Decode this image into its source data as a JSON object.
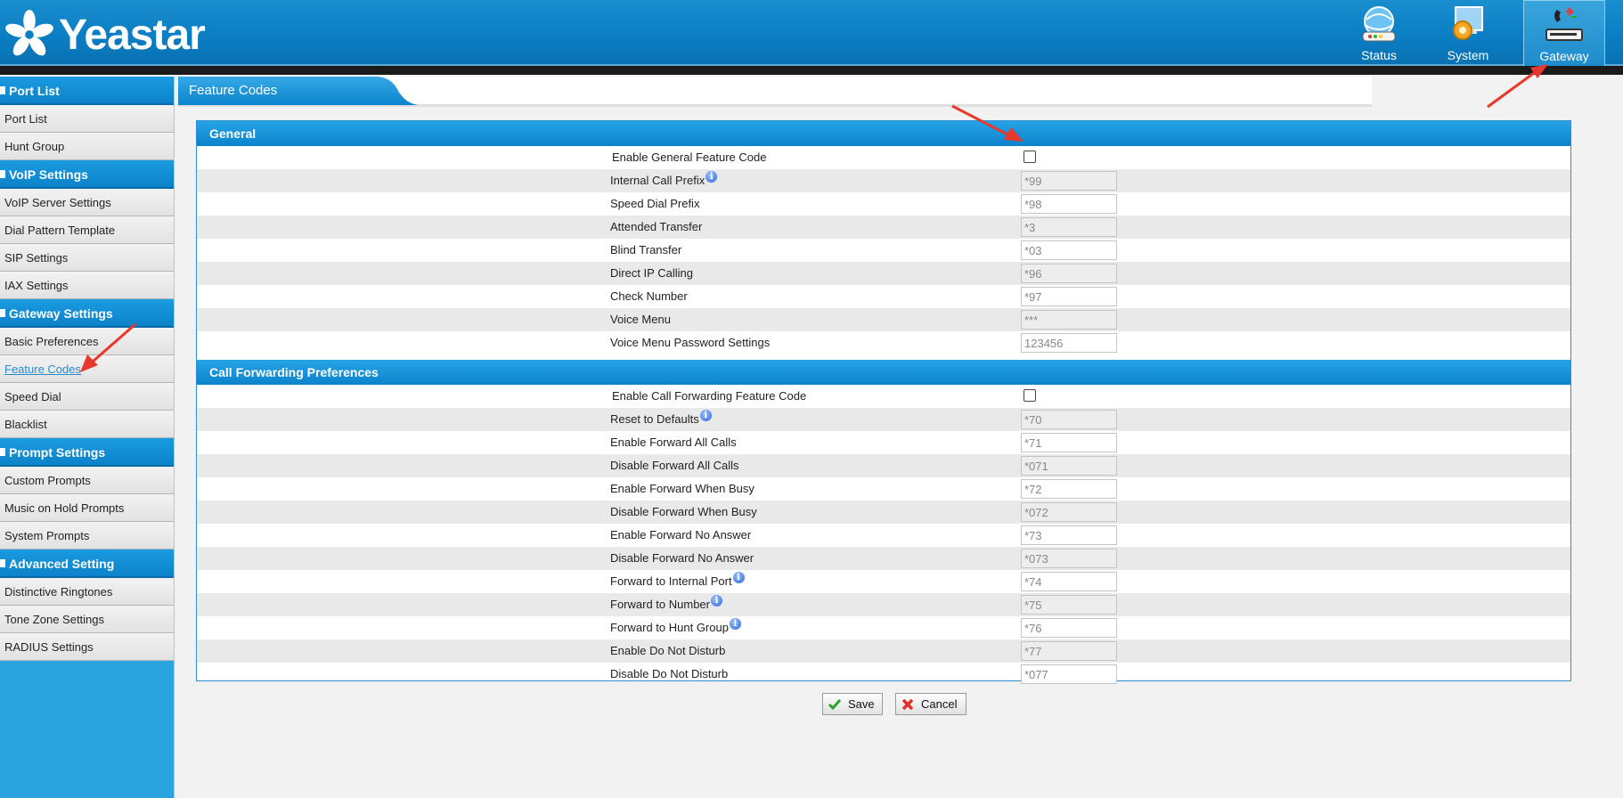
{
  "header": {
    "brand": "Yeastar",
    "nav": [
      {
        "label": "Status",
        "icon": "status-globe-icon"
      },
      {
        "label": "System",
        "icon": "system-gear-icon"
      },
      {
        "label": "Gateway",
        "icon": "gateway-phone-icon"
      }
    ]
  },
  "sidebar": {
    "sections": [
      {
        "title": "Port List",
        "items": [
          "Port List",
          "Hunt Group"
        ]
      },
      {
        "title": "VoIP Settings",
        "items": [
          "VoIP Server Settings",
          "Dial Pattern Template",
          "SIP Settings",
          "IAX Settings"
        ]
      },
      {
        "title": "Gateway Settings",
        "items": [
          "Basic Preferences",
          "Feature Codes",
          "Speed Dial",
          "Blacklist"
        ]
      },
      {
        "title": "Prompt Settings",
        "items": [
          "Custom Prompts",
          "Music on Hold Prompts",
          "System Prompts"
        ]
      },
      {
        "title": "Advanced Setting",
        "items": [
          "Distinctive Ringtones",
          "Tone Zone Settings",
          "RADIUS Settings"
        ]
      }
    ],
    "active_item": "Feature Codes"
  },
  "page": {
    "tab_title": "Feature Codes",
    "general": {
      "title": "General",
      "enable_label": "Enable General Feature Code",
      "enable_checked": false,
      "rows": [
        {
          "label": "Internal Call Prefix",
          "value": "*99",
          "info": true
        },
        {
          "label": "Speed Dial Prefix",
          "value": "*98"
        },
        {
          "label": "Attended Transfer",
          "value": "*3"
        },
        {
          "label": "Blind Transfer",
          "value": "*03"
        },
        {
          "label": "Direct IP Calling",
          "value": "*96"
        },
        {
          "label": "Check Number",
          "value": "*97"
        },
        {
          "label": "Voice Menu",
          "value": "***"
        },
        {
          "label": "Voice Menu Password Settings",
          "value": "123456"
        }
      ]
    },
    "call_forwarding": {
      "title": "Call Forwarding Preferences",
      "enable_label": "Enable Call Forwarding Feature Code",
      "enable_checked": false,
      "rows": [
        {
          "label": "Reset to Defaults",
          "value": "*70",
          "info": true
        },
        {
          "label": "Enable Forward All Calls",
          "value": "*71"
        },
        {
          "label": "Disable Forward All Calls",
          "value": "*071"
        },
        {
          "label": "Enable Forward When Busy",
          "value": "*72"
        },
        {
          "label": "Disable Forward When Busy",
          "value": "*072"
        },
        {
          "label": "Enable Forward No Answer",
          "value": "*73"
        },
        {
          "label": "Disable Forward No Answer",
          "value": "*073"
        },
        {
          "label": "Forward to Internal Port",
          "value": "*74",
          "info": true
        },
        {
          "label": "Forward to Number",
          "value": "*75",
          "info": true
        },
        {
          "label": "Forward to Hunt Group",
          "value": "*76",
          "info": true
        },
        {
          "label": "Enable Do Not Disturb",
          "value": "*77"
        },
        {
          "label": "Disable Do Not Disturb",
          "value": "*077"
        }
      ]
    },
    "buttons": {
      "save": "Save",
      "cancel": "Cancel"
    }
  },
  "colors": {
    "header_blue": "#0b7ec4",
    "sidebar_blue": "#2aa3de",
    "section_blue": "#0c82c9",
    "active_link": "#2a8cd0",
    "annotation_arrow": "#e8372b"
  }
}
